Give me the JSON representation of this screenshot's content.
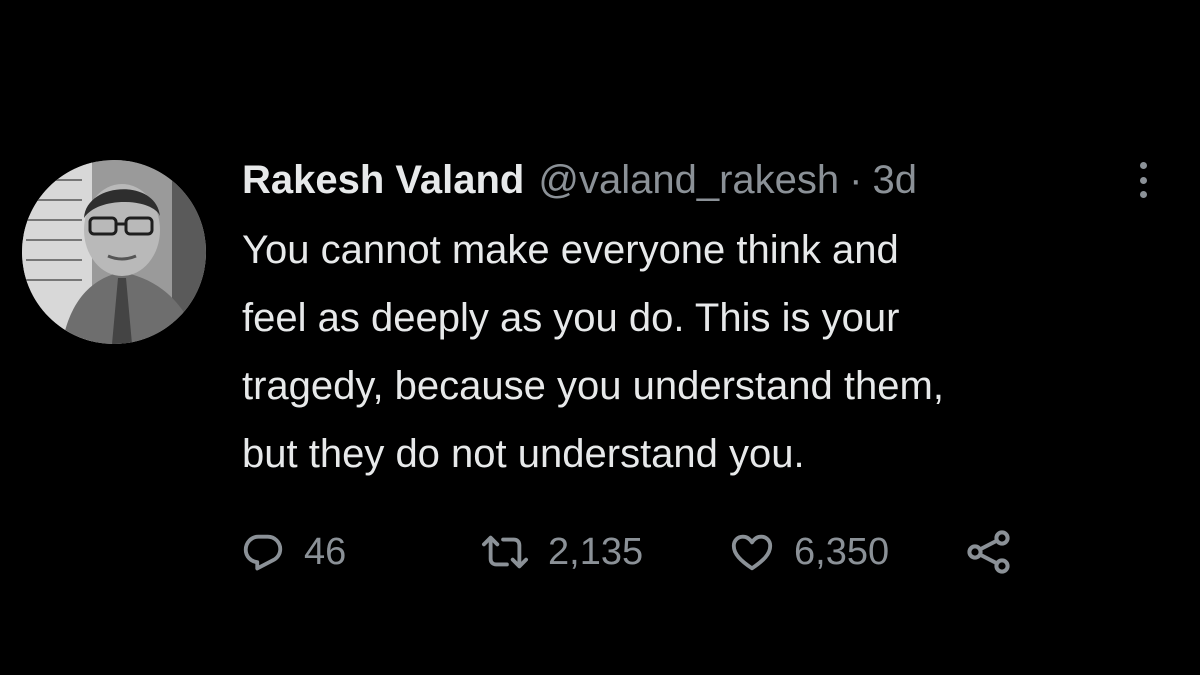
{
  "tweet": {
    "author": {
      "display_name": "Rakesh Valand",
      "handle": "@valand_rakesh",
      "avatar": "avatar-photo"
    },
    "separator": "·",
    "time": "3d",
    "more_icon": "more-vertical-icon",
    "text_lines": [
      "You cannot make everyone think and",
      "feel as deeply as you do. This is your",
      "tragedy, because you understand them,",
      "but they do not understand you."
    ],
    "actions": {
      "reply": {
        "icon": "reply-icon",
        "count": "46"
      },
      "retweet": {
        "icon": "retweet-icon",
        "count": "2,135"
      },
      "like": {
        "icon": "heart-icon",
        "count": "6,350"
      },
      "share": {
        "icon": "share-icon"
      }
    }
  },
  "colors": {
    "background": "#000000",
    "primary_text": "#e7e9ea",
    "secondary_text": "#8b9197"
  }
}
